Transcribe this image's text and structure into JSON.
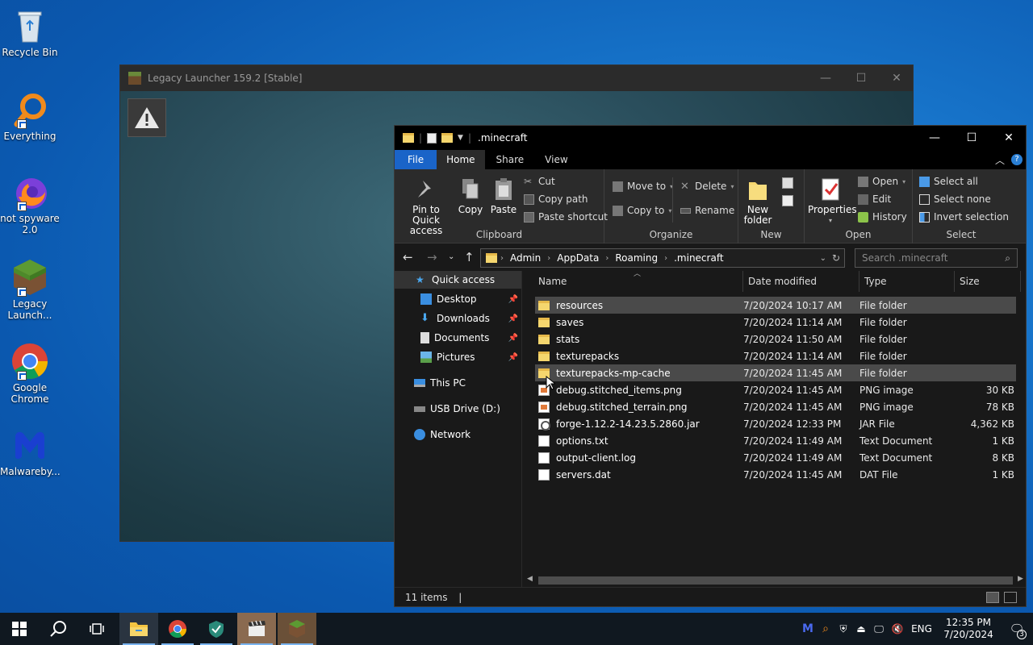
{
  "desktop": {
    "icons": [
      {
        "label": "Recycle Bin"
      },
      {
        "label": "Everything"
      },
      {
        "label": "not spyware 2.0"
      },
      {
        "label": "Legacy Launch..."
      },
      {
        "label": "Google Chrome"
      },
      {
        "label": "Malwareby..."
      }
    ]
  },
  "launcher": {
    "title": "Legacy Launcher 159.2 [Stable]",
    "minimize": "—",
    "maximize": "☐",
    "close": "✕",
    "warning": "⚠"
  },
  "explorer": {
    "title": ".minecraft",
    "window": {
      "minimize": "—",
      "maximize": "☐",
      "close": "✕"
    },
    "tabs": [
      "File",
      "Home",
      "Share",
      "View"
    ],
    "ribbon": {
      "clipboard": {
        "label": "Clipboard",
        "pin": "Pin to Quick access",
        "copy": "Copy",
        "paste": "Paste",
        "cut": "Cut",
        "copy_path": "Copy path",
        "paste_shortcut": "Paste shortcut"
      },
      "organize": {
        "label": "Organize",
        "move_to": "Move to",
        "copy_to": "Copy to",
        "delete": "Delete",
        "rename": "Rename"
      },
      "new": {
        "label": "New",
        "new_folder": "New folder"
      },
      "open": {
        "label": "Open",
        "properties": "Properties",
        "open": "Open",
        "edit": "Edit",
        "history": "History"
      },
      "select": {
        "label": "Select",
        "select_all": "Select all",
        "select_none": "Select none",
        "invert": "Invert selection"
      }
    },
    "address": {
      "crumbs": [
        "Admin",
        "AppData",
        "Roaming",
        ".minecraft"
      ],
      "search_placeholder": "Search .minecraft"
    },
    "nav": [
      {
        "label": "Quick access"
      },
      {
        "label": "Desktop"
      },
      {
        "label": "Downloads"
      },
      {
        "label": "Documents"
      },
      {
        "label": "Pictures"
      },
      {
        "label": "This PC"
      },
      {
        "label": "USB Drive (D:)"
      },
      {
        "label": "Network"
      }
    ],
    "columns": {
      "name": "Name",
      "date": "Date modified",
      "type": "Type",
      "size": "Size"
    },
    "files": [
      {
        "name": "resources",
        "date": "7/20/2024 10:17 AM",
        "type": "File folder",
        "size": "",
        "icon": "folder"
      },
      {
        "name": "saves",
        "date": "7/20/2024 11:14 AM",
        "type": "File folder",
        "size": "",
        "icon": "folder"
      },
      {
        "name": "stats",
        "date": "7/20/2024 11:50 AM",
        "type": "File folder",
        "size": "",
        "icon": "folder"
      },
      {
        "name": "texturepacks",
        "date": "7/20/2024 11:14 AM",
        "type": "File folder",
        "size": "",
        "icon": "folder"
      },
      {
        "name": "texturepacks-mp-cache",
        "date": "7/20/2024 11:45 AM",
        "type": "File folder",
        "size": "",
        "icon": "folder"
      },
      {
        "name": "debug.stitched_items.png",
        "date": "7/20/2024 11:45 AM",
        "type": "PNG image",
        "size": "30 KB",
        "icon": "png"
      },
      {
        "name": "debug.stitched_terrain.png",
        "date": "7/20/2024 11:45 AM",
        "type": "PNG image",
        "size": "78 KB",
        "icon": "png"
      },
      {
        "name": "forge-1.12.2-14.23.5.2860.jar",
        "date": "7/20/2024 12:33 PM",
        "type": "JAR File",
        "size": "4,362 KB",
        "icon": "jar"
      },
      {
        "name": "options.txt",
        "date": "7/20/2024 11:49 AM",
        "type": "Text Document",
        "size": "1 KB",
        "icon": "doc"
      },
      {
        "name": "output-client.log",
        "date": "7/20/2024 11:49 AM",
        "type": "Text Document",
        "size": "8 KB",
        "icon": "doc"
      },
      {
        "name": "servers.dat",
        "date": "7/20/2024 11:45 AM",
        "type": "DAT File",
        "size": "1 KB",
        "icon": "doc"
      }
    ],
    "status": "11 items"
  },
  "taskbar": {
    "lang": "ENG",
    "time": "12:35 PM",
    "date": "7/20/2024",
    "notifications": "3"
  }
}
